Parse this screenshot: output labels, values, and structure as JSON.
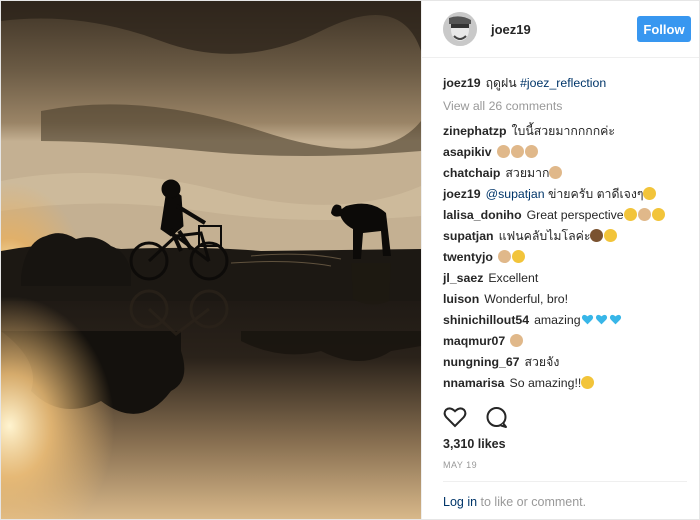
{
  "post": {
    "author": "joez19",
    "follow_label": "Follow",
    "caption_user": "joez19",
    "caption_text": "ฤดูฝน",
    "caption_hashtag": "#joez_reflection",
    "view_all": "View all 26 comments",
    "comments": [
      {
        "user": "zinephatzp",
        "text": "ใบนี้สวยมากกกกค่ะ",
        "emojis": []
      },
      {
        "user": "asapikiv",
        "text": "",
        "emojis": [
          "thumbs-up",
          "thumbs-up",
          "thumbs-up"
        ]
      },
      {
        "user": "chatchaip",
        "text": "สวยมาก",
        "emojis": [
          "thumbs-up"
        ]
      },
      {
        "user": "joez19",
        "mention": "@supatjan",
        "text": "ข่ายครับ ตาดีเจงๆ",
        "emojis": [
          "raised-hands"
        ]
      },
      {
        "user": "lalisa_doniho",
        "text": "Great perspective",
        "emojis": [
          "smiling-face",
          "ok-hand",
          "sparkles"
        ]
      },
      {
        "user": "supatjan",
        "text": "แฟนคลับไมโลค่ะ",
        "emojis": [
          "woman-face",
          "grinning-face"
        ]
      },
      {
        "user": "twentyjo",
        "text": "",
        "emojis": [
          "thumbs-up",
          "clapping-hands"
        ]
      },
      {
        "user": "jl_saez",
        "text": "Excellent",
        "emojis": []
      },
      {
        "user": "luison",
        "text": "Wonderful, bro!",
        "emojis": []
      },
      {
        "user": "shinichillout54",
        "text": "amazing",
        "emojis": [
          "blue-heart",
          "blue-heart",
          "blue-heart"
        ]
      },
      {
        "user": "maqmur07",
        "text": "",
        "emojis": [
          "thumbs-up"
        ]
      },
      {
        "user": "nungning_67",
        "text": "สวยจัง",
        "emojis": []
      },
      {
        "user": "nnamarisa",
        "text": "So amazing!!",
        "emojis": [
          "heart-eyes"
        ]
      }
    ],
    "likes": "3,310 likes",
    "date": "MAY 19",
    "login_link": "Log in",
    "login_rest": " to like or comment."
  },
  "colors": {
    "accent": "#3897f0",
    "link": "#003569",
    "muted": "#999999",
    "blue_heart": "#38b6e8",
    "emoji_yellow": "#f2c43a",
    "emoji_skin": "#e0b88a"
  },
  "icons": {
    "like": "heart-outline-icon",
    "comment": "speech-bubble-icon"
  }
}
